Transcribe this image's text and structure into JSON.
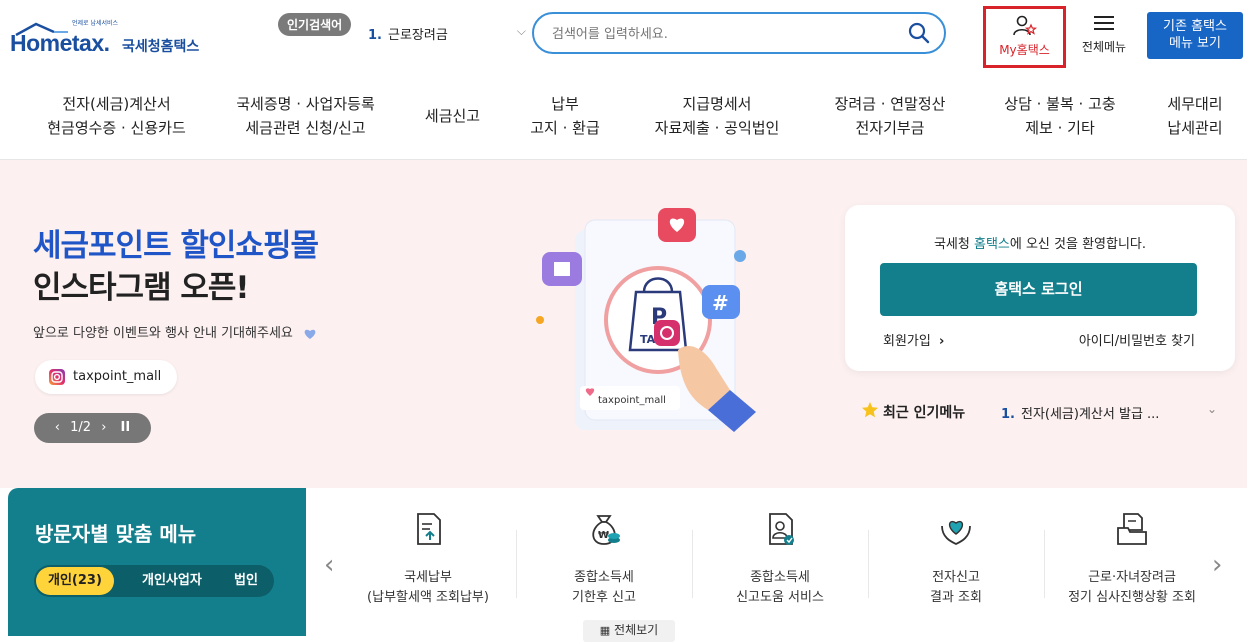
{
  "header": {
    "logo_small": "언제로 납세서비스",
    "logo_word": "Hometax.",
    "logo_kr": "국세청홈택스",
    "popular_badge": "인기검색어",
    "popular_num": "1.",
    "popular_text": "근로장려금",
    "search_placeholder": "검색어를 입력하세요.",
    "my_hometax": "My홈택스",
    "all_menu": "전체메뉴",
    "old_menu_line1": "기존 홈택스",
    "old_menu_line2": "메뉴 보기"
  },
  "gnb": [
    {
      "l1": "전자(세금)계산서",
      "l2": "현금영수증 · 신용카드"
    },
    {
      "l1": "국세증명 · 사업자등록",
      "l2": "세금관련 신청/신고"
    },
    {
      "l1": "세금신고",
      "l2": ""
    },
    {
      "l1": "납부",
      "l2": "고지 · 환급"
    },
    {
      "l1": "지급명세서",
      "l2": "자료제출 · 공익법인"
    },
    {
      "l1": "장려금 · 연말정산",
      "l2": "전자기부금"
    },
    {
      "l1": "상담 · 불복 · 고충",
      "l2": "제보 · 기타"
    },
    {
      "l1": "세무대리",
      "l2": "납세관리"
    }
  ],
  "hero": {
    "title1": "세금포인트 할인쇼핑몰",
    "title2": "인스타그램 오픈!",
    "desc": "앞으로 다양한 이벤트와 행사 안내 기대해주세요",
    "insta_handle": "taxpoint_mall",
    "pager": "1/2",
    "pager_prev": "‹",
    "pager_next": "›",
    "pager_pause": "II",
    "illus_handle": "taxpoint_mall"
  },
  "login": {
    "welcome_pre": "국세청 ",
    "welcome_hl": "홈택스",
    "welcome_post": "에 오신 것을 환영합니다.",
    "button": "홈택스 로그인",
    "join": "회원가입",
    "join_arrow": "›",
    "find": "아이디/비밀번호 찾기"
  },
  "recent": {
    "label": "최근 인기메뉴",
    "num": "1.",
    "text": "전자(세금)계산서 발급 ...",
    "chevron": "⌄"
  },
  "visitor": {
    "title": "방문자별 맞춤 메뉴",
    "tabs": [
      "개인(23)",
      "개인사업자",
      "법인"
    ]
  },
  "quick": {
    "prev": "‹",
    "next": "›",
    "items": [
      {
        "l1": "국세납부",
        "l2": "(납부할세액 조회납부)",
        "icon": "document-upload-icon"
      },
      {
        "l1": "종합소득세",
        "l2": "기한후 신고",
        "icon": "money-bag-icon"
      },
      {
        "l1": "종합소득세",
        "l2": "신고도움 서비스",
        "icon": "document-person-icon"
      },
      {
        "l1": "전자신고",
        "l2": "결과 조회",
        "icon": "heart-hands-icon"
      },
      {
        "l1": "근로·자녀장려금",
        "l2": "정기 심사진행상황 조회",
        "icon": "folder-document-icon"
      }
    ],
    "view_all": "전체보기"
  },
  "colors": {
    "brand_blue": "#1a4fa0",
    "teal": "#147f8c",
    "hero_bg": "#fcf0f0",
    "highlight_red": "#d8232a",
    "tab_yellow": "#ffd43b"
  }
}
